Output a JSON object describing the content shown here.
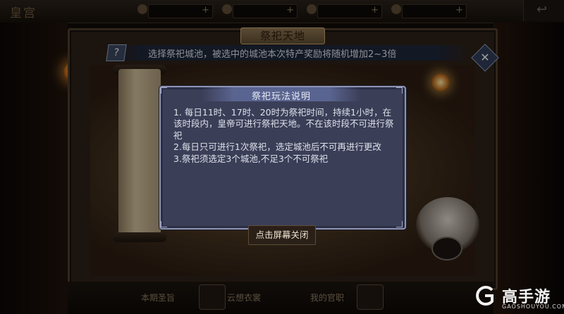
{
  "topbar": {
    "palace_title": "皇宫",
    "plus": "+",
    "back_glyph": "↩"
  },
  "frame": {
    "title": "祭祀天地",
    "hint_icon": "?",
    "hint_text": "选择祭祀城池，被选中的城池本次特产奖励将随机增加2~3倍",
    "close_glyph": "✕"
  },
  "bottom": {
    "left_label": "本期圣旨",
    "mid_label": "云想衣裳",
    "right_label": "我的官职"
  },
  "dialog": {
    "title": "祭祀玩法说明",
    "rules": [
      "1. 每日11时、17时、20时为祭祀时间，持续1小时，在该时段内，皇帝可进行祭祀天地。不在该时段不可进行祭祀",
      "2.每日只可进行1次祭祀，选定城池后不可再进行更改",
      "3.祭祀须选定3个城池,不足3个不可祭祀"
    ],
    "dismiss_label": "点击屏幕关闭"
  },
  "watermark": {
    "brand": "高手游",
    "site": "GAOSHOUYOU.COM"
  },
  "colors": {
    "dialog_bg": "#3b3e57",
    "dialog_border": "#8f95b4",
    "frame_border": "#4b3b2a",
    "title_tab": "#8a7350"
  },
  "icons": [
    "question-icon",
    "close-icon",
    "back-icon",
    "lantern-icon",
    "brand-logo-icon"
  ]
}
